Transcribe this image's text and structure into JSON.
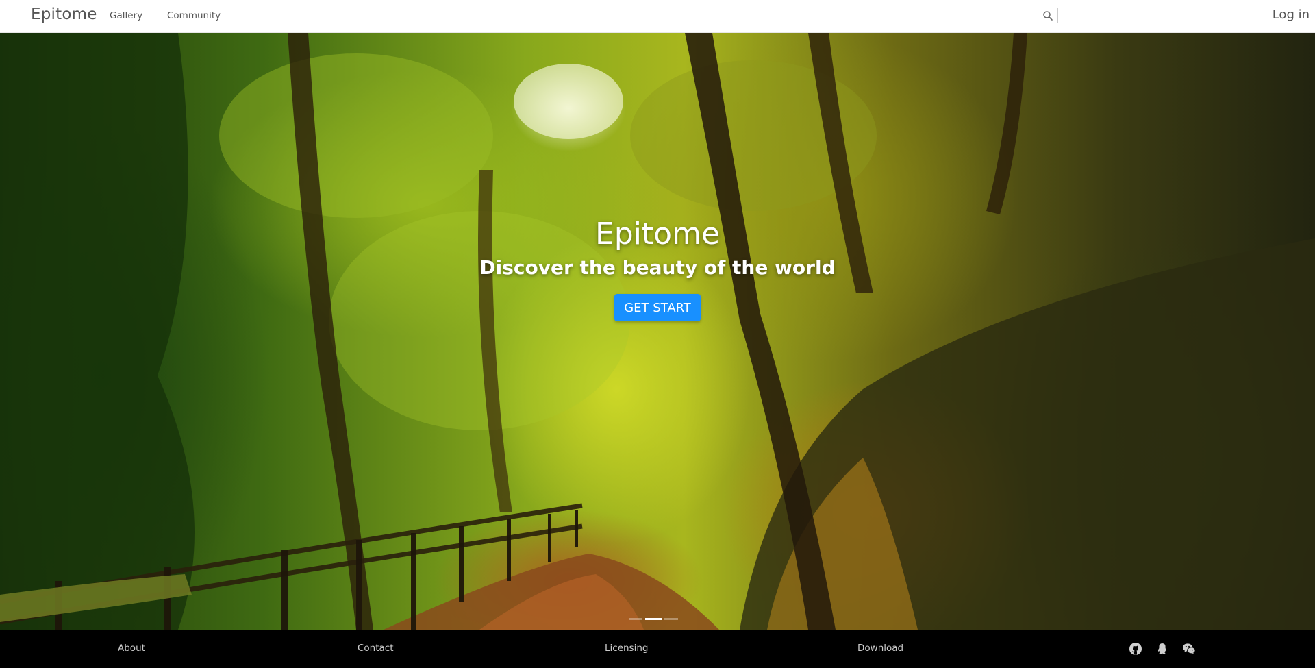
{
  "header": {
    "brand": "Epitome",
    "nav": [
      {
        "label": "Gallery"
      },
      {
        "label": "Community"
      }
    ],
    "search": {
      "placeholder": "",
      "value": "",
      "icon": "search-icon"
    },
    "login_label": "Log in"
  },
  "hero": {
    "title": "Epitome",
    "subtitle": "Discover the beauty of the world",
    "cta_label": "GET START",
    "cta_color": "#1890ff",
    "carousel": {
      "slides": 3,
      "active_index": 1
    },
    "image": "forest-path-photo"
  },
  "footer": {
    "links": [
      {
        "label": "About"
      },
      {
        "label": "Contact"
      },
      {
        "label": "Licensing"
      },
      {
        "label": "Download"
      }
    ],
    "social": [
      {
        "icon": "github-icon"
      },
      {
        "icon": "qq-icon"
      },
      {
        "icon": "wechat-icon"
      }
    ]
  }
}
